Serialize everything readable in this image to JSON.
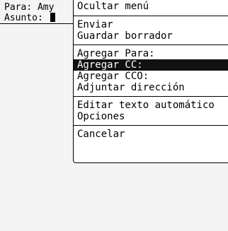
{
  "compose": {
    "to_label": "Para:",
    "to_value": "Amy",
    "subject_label": "Asunto:"
  },
  "menu": {
    "groups": [
      {
        "items": [
          {
            "label": "Ocultar menú",
            "selected": false
          }
        ]
      },
      {
        "items": [
          {
            "label": "Enviar",
            "selected": false
          },
          {
            "label": "Guardar borrador",
            "selected": false
          }
        ]
      },
      {
        "items": [
          {
            "label": "Agregar Para:",
            "selected": false
          },
          {
            "label": "Agregar CC:",
            "selected": true
          },
          {
            "label": "Agregar CCO:",
            "selected": false
          },
          {
            "label": "Adjuntar dirección",
            "selected": false
          }
        ]
      },
      {
        "items": [
          {
            "label": "Editar texto automático",
            "selected": false
          },
          {
            "label": "Opciones",
            "selected": false
          }
        ]
      },
      {
        "items": [
          {
            "label": "Cancelar",
            "selected": false
          }
        ]
      }
    ]
  }
}
